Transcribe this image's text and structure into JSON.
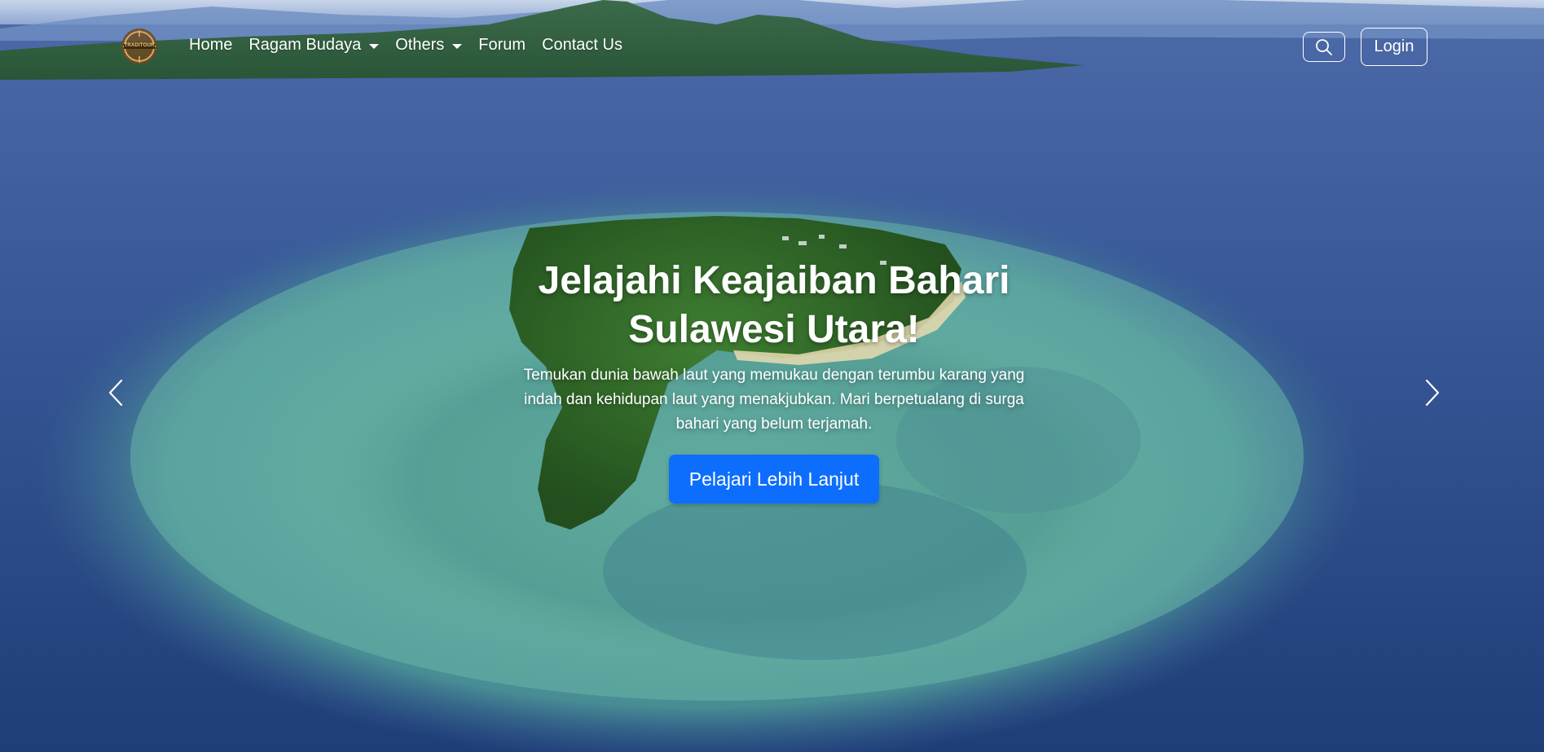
{
  "nav": {
    "logo_text": "TRADITOUR",
    "links": [
      {
        "label": "Home",
        "dropdown": false
      },
      {
        "label": "Ragam Budaya",
        "dropdown": true
      },
      {
        "label": "Others",
        "dropdown": true
      },
      {
        "label": "Forum",
        "dropdown": false
      },
      {
        "label": "Contact Us",
        "dropdown": false
      }
    ],
    "search_icon": "search-icon",
    "login_label": "Login"
  },
  "hero": {
    "title": "Jelajahi Keajaiban Bahari Sulawesi Utara!",
    "description": "Temukan dunia bawah laut yang memukau dengan terumbu karang yang indah dan kehidupan laut yang menakjubkan. Mari berpetualang di surga bahari yang belum terjamah.",
    "cta_label": "Pelajari Lebih Lanjut",
    "prev_icon": "chevron-left-icon",
    "next_icon": "chevron-right-icon"
  },
  "colors": {
    "accent": "#0d6efd",
    "text": "#ffffff",
    "sea": "#2f4f8f",
    "reef": "#5fb4a8",
    "island": "#2e6b2a"
  }
}
